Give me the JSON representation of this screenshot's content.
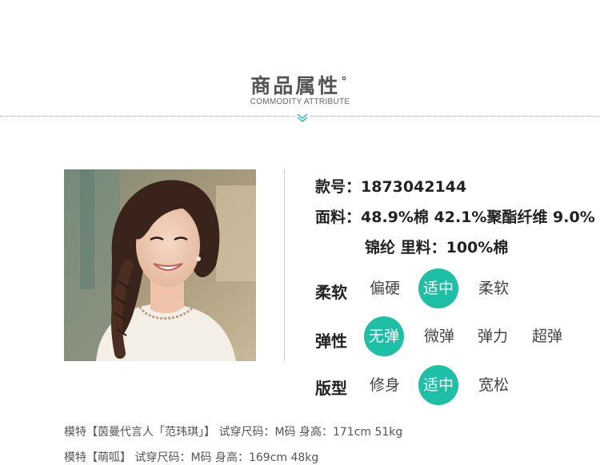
{
  "header": {
    "title": "商品属性",
    "title_mark": "°",
    "subtitle": "COMMODITY ATTRIBUTE",
    "accent_color": "#1dbfa5"
  },
  "product": {
    "photo_alt": "model-photo",
    "style_number": "款号：1873042144",
    "fabric_line1": "面料：48.9%棉 42.1%聚酯纤维 9.0%",
    "fabric_line2": "锦纶 里料：100%棉"
  },
  "attributes": [
    {
      "label": "柔软",
      "options": [
        {
          "text": "偏硬",
          "selected": false
        },
        {
          "text": "适中",
          "selected": true
        },
        {
          "text": "柔软",
          "selected": false
        }
      ]
    },
    {
      "label": "弹性",
      "options": [
        {
          "text": "无弹",
          "selected": true
        },
        {
          "text": "微弹",
          "selected": false
        },
        {
          "text": "弹力",
          "selected": false
        },
        {
          "text": "超弹",
          "selected": false
        }
      ]
    },
    {
      "label": "版型",
      "options": [
        {
          "text": "修身",
          "selected": false
        },
        {
          "text": "适中",
          "selected": true
        },
        {
          "text": "宽松",
          "selected": false
        }
      ]
    }
  ],
  "models": [
    "模特【茵曼代言人「范玮琪」】 试穿尺码：M码 身高：171cm 51kg",
    "模特【萌呱】 试穿尺码：M码 身高：169cm 48kg"
  ]
}
